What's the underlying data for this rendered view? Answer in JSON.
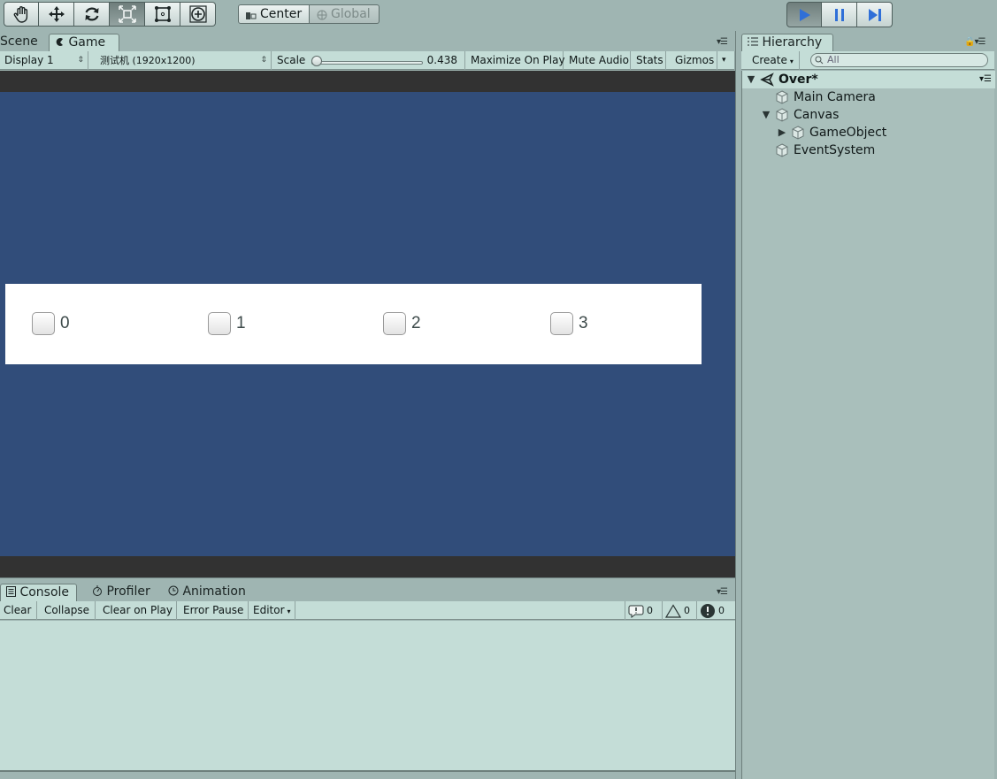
{
  "toolbar": {
    "transform_tools": [
      {
        "icon": "hand-icon",
        "active": false
      },
      {
        "icon": "move-icon",
        "active": false
      },
      {
        "icon": "rotate-icon",
        "active": false
      },
      {
        "icon": "scale-icon",
        "active": true
      },
      {
        "icon": "rect-tool-icon",
        "active": false
      },
      {
        "icon": "transform-tool-icon",
        "active": false
      }
    ],
    "pivot_mode": "Center",
    "pivot_rotation": "Global",
    "play_controls": [
      "play-icon",
      "pause-icon",
      "step-icon"
    ]
  },
  "game_panel": {
    "tabs": [
      "Scene",
      "Game"
    ],
    "active_tab": "Game",
    "display": "Display 1",
    "resolution": "测试机 (1920x1200)",
    "scale_label": "Scale",
    "scale_value": "0.438",
    "scale_fraction": 0.02,
    "maximize_on_play": "Maximize On Play",
    "mute_audio": "Mute Audio",
    "stats": "Stats",
    "gizmos": "Gizmos",
    "toggles": [
      "0",
      "1",
      "2",
      "3"
    ]
  },
  "console_panel": {
    "tabs": [
      "Console",
      "Profiler",
      "Animation"
    ],
    "active_tab": "Console",
    "clear": "Clear",
    "collapse": "Collapse",
    "clear_on_play": "Clear on Play",
    "error_pause": "Error Pause",
    "editor": "Editor",
    "info_count": "0",
    "warning_count": "0",
    "error_count": "0"
  },
  "hierarchy_panel": {
    "tab": "Hierarchy",
    "create": "Create",
    "search_placeholder": "All",
    "scene": "Over*",
    "items": [
      {
        "label": "Main Camera",
        "depth": 1,
        "expand": "none"
      },
      {
        "label": "Canvas",
        "depth": 1,
        "expand": "open"
      },
      {
        "label": "GameObject",
        "depth": 2,
        "expand": "closed"
      },
      {
        "label": "EventSystem",
        "depth": 1,
        "expand": "none"
      }
    ]
  },
  "colors": {
    "editor_bg": "#9fb5b2",
    "panel_bg": "#c4ddd7",
    "game_bg": "#314d7a",
    "play_blue": "#2f6fd8"
  }
}
